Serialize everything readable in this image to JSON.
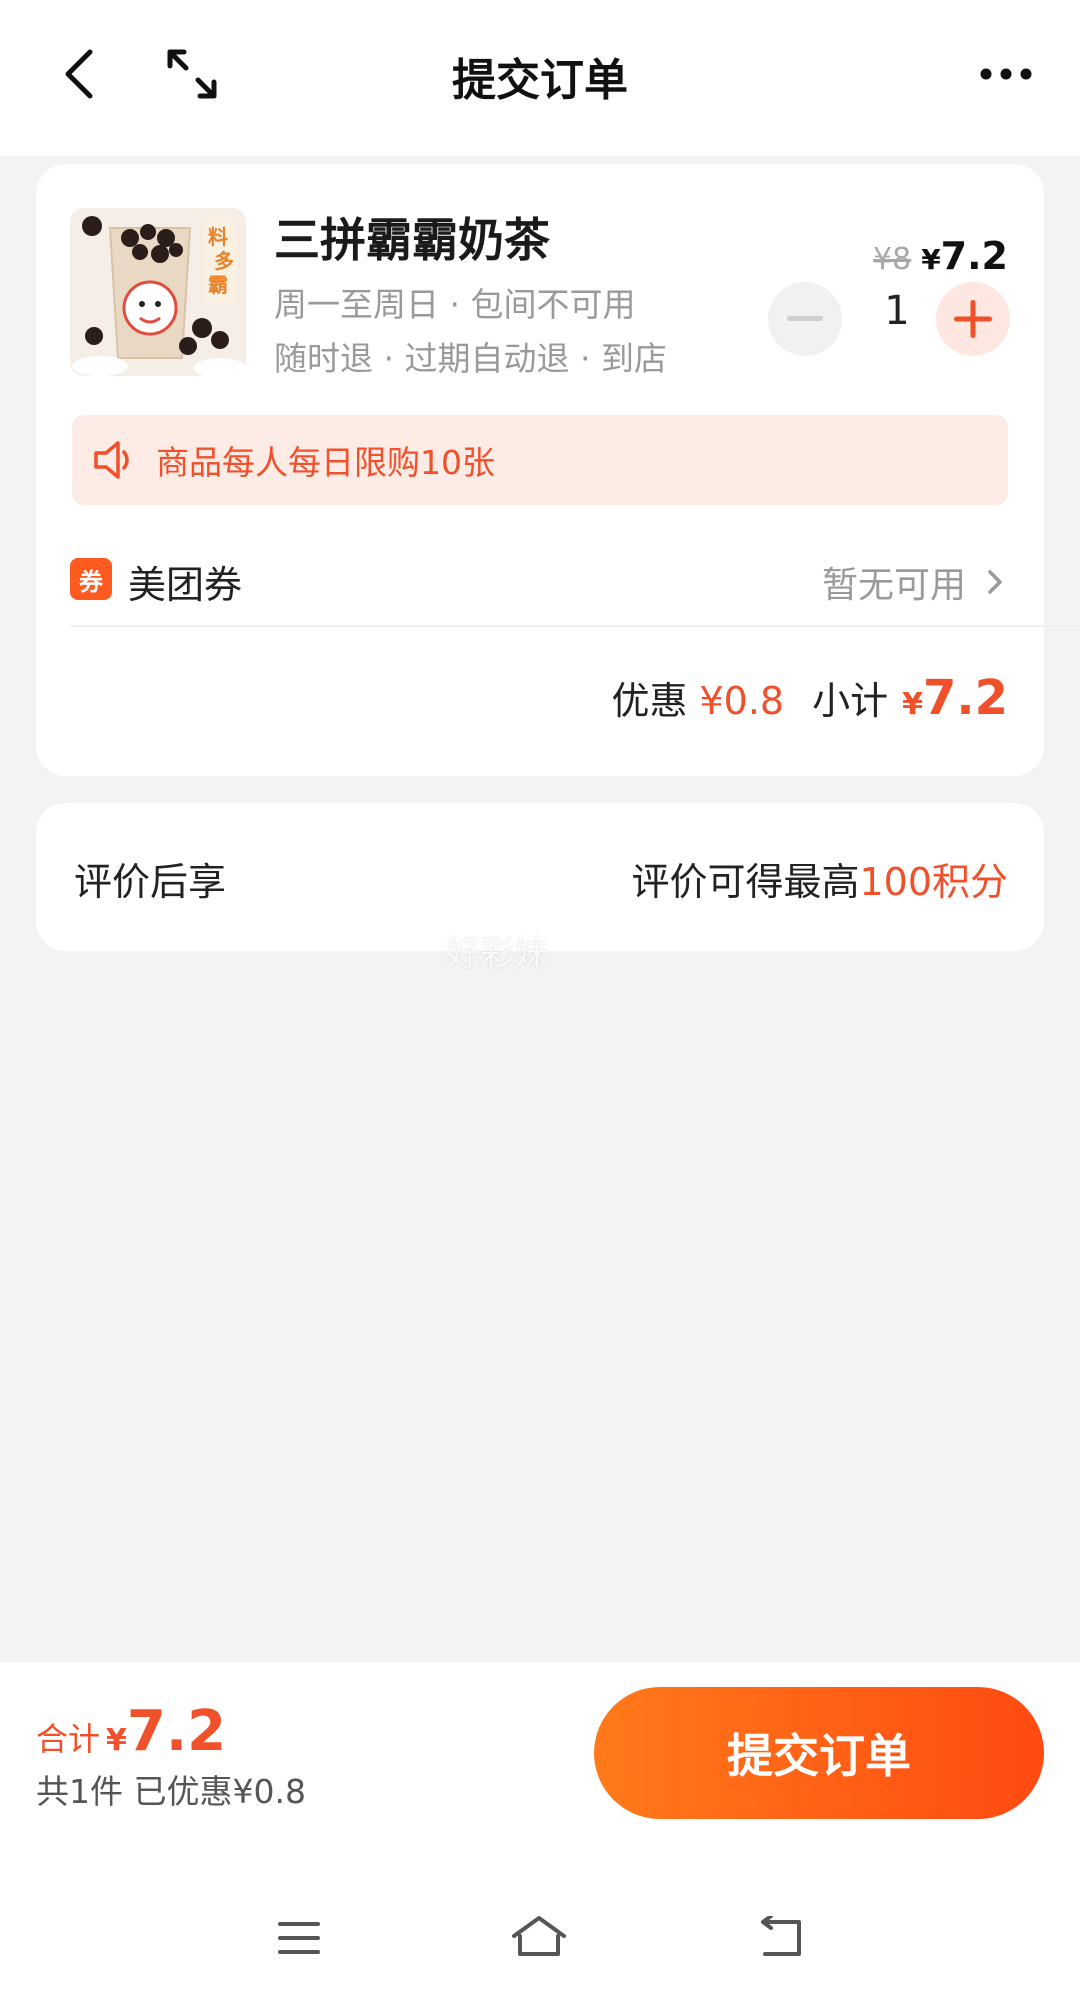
{
  "header": {
    "title": "提交订单",
    "icons": [
      "chevron-left-icon",
      "expand-icon",
      "more-icon"
    ]
  },
  "product": {
    "name": "三拼霸霸奶茶",
    "desc_line1": "周一至周日 · 包间不可用",
    "desc_line2": "随时退 · 过期自动退 · 到店",
    "price_original": "¥8",
    "price_symbol": "¥",
    "price_now": "7.2",
    "quantity": "1"
  },
  "limit": {
    "text": "商品每人每日限购10张",
    "icon": "speaker-icon"
  },
  "coupon": {
    "tag": "券",
    "label": "美团券",
    "status": "暂无可用"
  },
  "summary": {
    "discount_label": "优惠",
    "discount_value": "¥0.8",
    "subtotal_label": "小计",
    "subtotal_symbol": "¥",
    "subtotal_value": "7.2"
  },
  "review": {
    "label": "评价后享",
    "value_prefix": "评价可得最高",
    "value_points": "100积分"
  },
  "watermark": "好彩妹",
  "footer": {
    "total_label": "合计",
    "total_symbol": "¥",
    "total_value": "7.2",
    "total_sub": "共1件  已优惠¥0.8",
    "submit_label": "提交订单"
  },
  "colors": {
    "accent": "#f0502a",
    "button_start": "#ff7a1a",
    "button_end": "#ff4a12",
    "background": "#f3f3f3"
  }
}
